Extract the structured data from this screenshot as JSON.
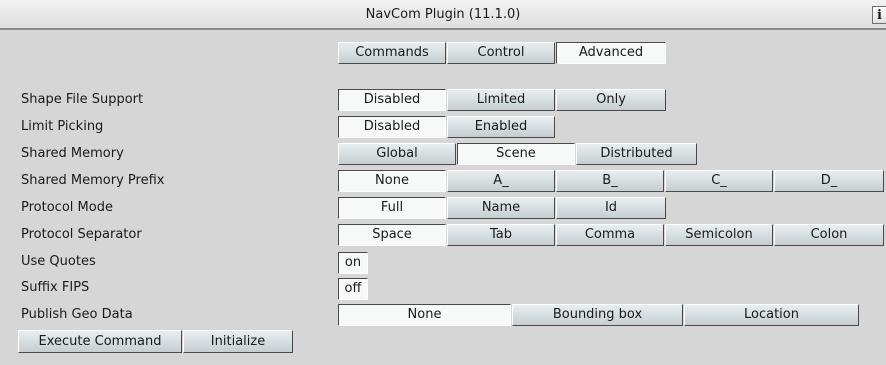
{
  "window": {
    "title": "NavCom Plugin (11.1.0)",
    "info_glyph": "i"
  },
  "tabs": [
    {
      "label": "Commands"
    },
    {
      "label": "Control"
    },
    {
      "label": "Advanced",
      "selected": true
    }
  ],
  "settings": {
    "shape_file_support": {
      "label": "Shape File Support",
      "options": [
        "Disabled",
        "Limited",
        "Only"
      ],
      "selected": "Disabled"
    },
    "limit_picking": {
      "label": "Limit Picking",
      "options": [
        "Disabled",
        "Enabled"
      ],
      "selected": "Disabled"
    },
    "shared_memory": {
      "label": "Shared  Memory",
      "options": [
        "Global",
        "Scene",
        "Distributed"
      ],
      "selected": "Scene"
    },
    "shared_memory_prefix": {
      "label": "Shared Memory Prefix",
      "options": [
        "None",
        "A_",
        "B_",
        "C_",
        "D_"
      ],
      "selected": "None"
    },
    "protocol_mode": {
      "label": "Protocol Mode",
      "options": [
        "Full",
        "Name",
        "Id"
      ],
      "selected": "Full"
    },
    "protocol_separator": {
      "label": "Protocol Separator",
      "options": [
        "Space",
        "Tab",
        "Comma",
        "Semicolon",
        "Colon"
      ],
      "selected": "Space"
    },
    "use_quotes": {
      "label": "Use Quotes",
      "value": "on"
    },
    "suffix_fips": {
      "label": "Suffix FIPS",
      "value": "off"
    },
    "publish_geo_data": {
      "label": "Publish Geo Data",
      "options": [
        "None",
        "Bounding box",
        "Location"
      ],
      "selected": "None"
    }
  },
  "actions": {
    "execute_label": "Execute Command",
    "initialize_label": "Initialize"
  }
}
